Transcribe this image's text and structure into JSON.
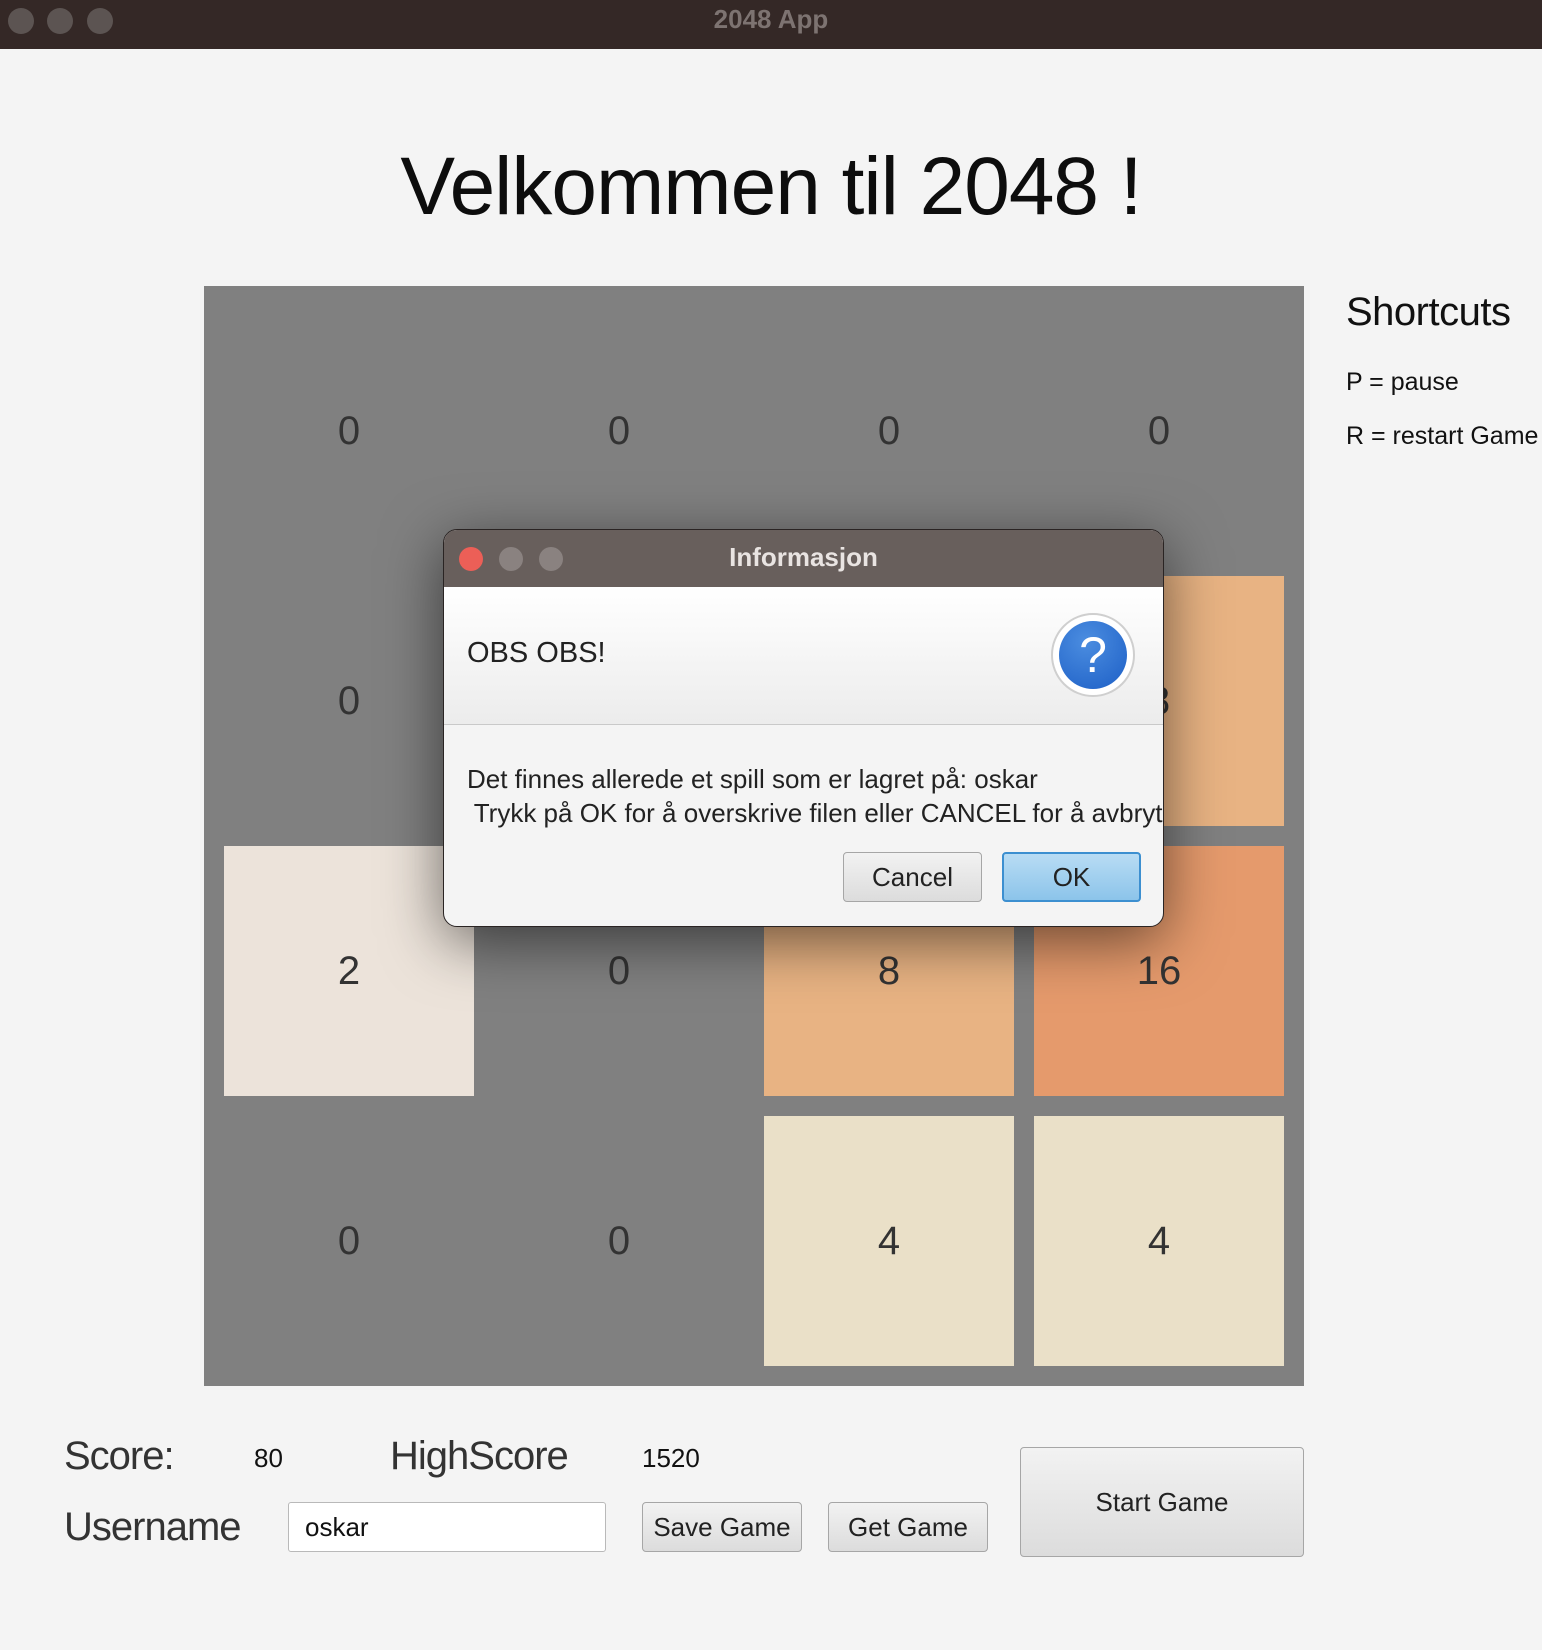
{
  "window": {
    "title": "2048 App"
  },
  "heading": "Velkommen til 2048 !",
  "board": {
    "tiles": [
      {
        "value": "0",
        "color": "#808080"
      },
      {
        "value": "0",
        "color": "#808080"
      },
      {
        "value": "0",
        "color": "#808080"
      },
      {
        "value": "0",
        "color": "#808080"
      },
      {
        "value": "0",
        "color": "#808080"
      },
      {
        "value": "",
        "color": "#808080"
      },
      {
        "value": "",
        "color": "#808080"
      },
      {
        "value": "8",
        "color": "#e8b383"
      },
      {
        "value": "2",
        "color": "#ece3da"
      },
      {
        "value": "0",
        "color": "#808080"
      },
      {
        "value": "8",
        "color": "#e8b383"
      },
      {
        "value": "16",
        "color": "#e59a6c"
      },
      {
        "value": "0",
        "color": "#808080"
      },
      {
        "value": "0",
        "color": "#808080"
      },
      {
        "value": "4",
        "color": "#eae0c8"
      },
      {
        "value": "4",
        "color": "#eae0c8"
      }
    ]
  },
  "shortcuts": {
    "title": "Shortcuts",
    "items": [
      "P = pause",
      "R = restart Game"
    ]
  },
  "bottom": {
    "score_label": "Score:",
    "score_value": "80",
    "highscore_label": "HighScore",
    "highscore_value": "1520",
    "username_label": "Username",
    "username_value": "oskar",
    "save_label": "Save Game",
    "get_label": "Get Game",
    "start_label": "Start Game"
  },
  "dialog": {
    "title": "Informasjon",
    "header": "OBS OBS!",
    "icon": "question-icon",
    "message_line1": "Det finnes allerede et spill som er lagret på: oskar",
    "message_line2": " Trykk på OK for å overskrive filen eller CANCEL for å avbryte.",
    "cancel_label": "Cancel",
    "ok_label": "OK"
  },
  "colors": {
    "titlebar": "#342826",
    "board": "#808080",
    "accent": "#3c8fd0"
  }
}
